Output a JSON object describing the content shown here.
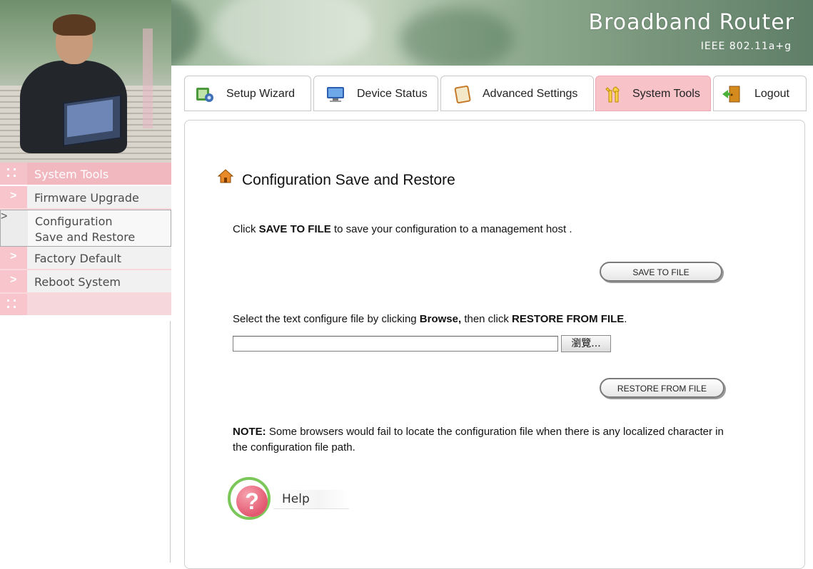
{
  "header": {
    "title": "Broadband Router",
    "subtitle": "IEEE 802.11a+g"
  },
  "tabs": [
    {
      "label": "Setup Wizard",
      "icon": "setup-wizard-icon",
      "active": false
    },
    {
      "label": "Device Status",
      "icon": "monitor-icon",
      "active": false
    },
    {
      "label": "Advanced Settings",
      "icon": "notebook-icon",
      "active": false
    },
    {
      "label": "System Tools",
      "icon": "tools-icon",
      "active": true
    },
    {
      "label": "Logout",
      "icon": "door-exit-icon",
      "active": false
    }
  ],
  "sidebar": {
    "section": "System Tools",
    "items": [
      {
        "label": "Firmware Upgrade",
        "active": false
      },
      {
        "label_line1": "Configuration",
        "label_line2": "Save and Restore",
        "active": true
      },
      {
        "label": "Factory Default",
        "active": false
      },
      {
        "label": "Reboot System",
        "active": false
      }
    ]
  },
  "content": {
    "title": "Configuration Save and Restore",
    "save": {
      "pre": "Click ",
      "bold": "SAVE TO FILE",
      "post": " to save your configuration to a management host .",
      "button": "SAVE TO FILE"
    },
    "restore": {
      "pre": "Select the text configure file by clicking ",
      "bold1": "Browse,",
      "mid": " then click ",
      "bold2": "RESTORE FROM FILE",
      "post": ".",
      "file_value": "",
      "browse_button": "瀏覽...",
      "button": "RESTORE FROM FILE"
    },
    "note": {
      "label": "NOTE:",
      "text": " Some browsers would fail to locate the configuration file when there is any localized character in the configuration file path."
    },
    "help": "Help"
  },
  "colors": {
    "accent_pink": "#f7c2c8",
    "sidebar_pink": "#f2b8c0",
    "help_green": "#7cc75a"
  }
}
